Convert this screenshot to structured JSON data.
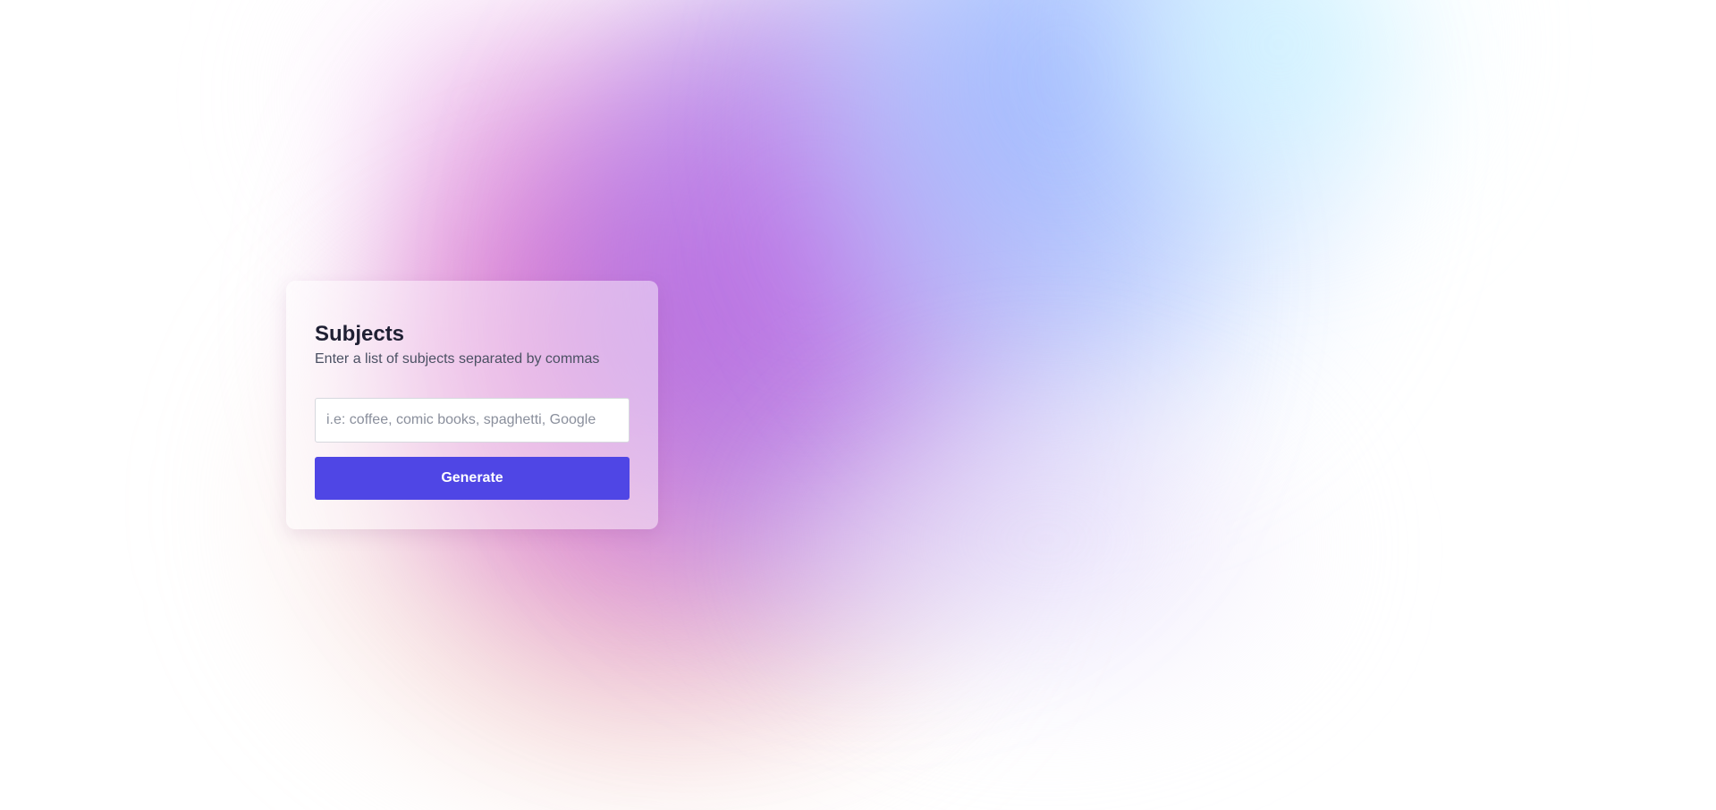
{
  "card": {
    "title": "Subjects",
    "subtitle": "Enter a list of subjects separated by commas",
    "input": {
      "value": "",
      "placeholder": "i.e: coffee, comic books, spaghetti, Google"
    },
    "button_label": "Generate"
  },
  "colors": {
    "primary_button": "#4f46e5",
    "title_text": "#1f2033",
    "subtitle_text": "#4b5163"
  }
}
